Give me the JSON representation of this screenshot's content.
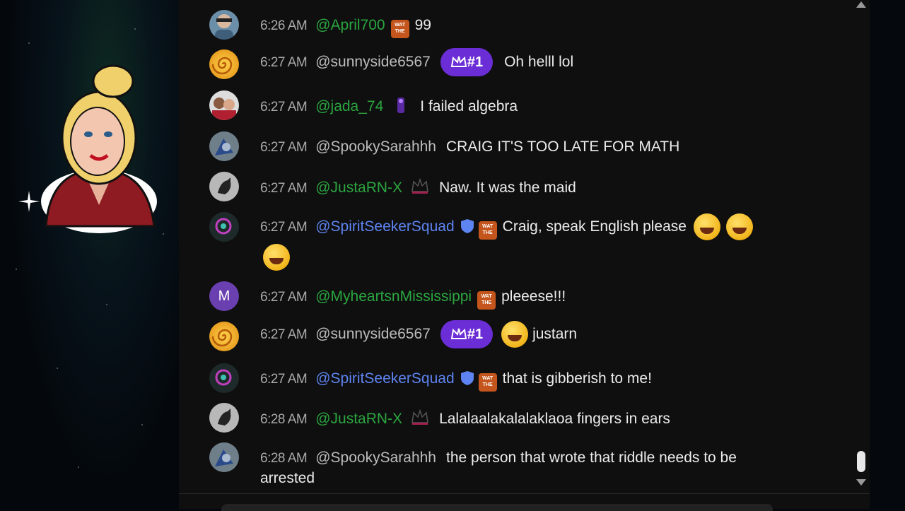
{
  "messages": [
    {
      "time": "6:26 AM",
      "user": "@April700",
      "text": "99"
    },
    {
      "time": "6:27 AM",
      "user": "@sunnyside6567",
      "badge": "#1",
      "text": "Oh helll lol"
    },
    {
      "time": "6:27 AM",
      "user": "@jada_74",
      "text": "I failed algebra"
    },
    {
      "time": "6:27 AM",
      "user": "@SpookySarahhh",
      "text": "CRAIG IT'S TOO LATE FOR MATH"
    },
    {
      "time": "6:27 AM",
      "user": "@JustaRN-X",
      "text": "Naw. It was the maid"
    },
    {
      "time": "6:27 AM",
      "user": "@SpiritSeekerSquad",
      "text": "Craig, speak English please"
    },
    {
      "time": "6:27 AM",
      "user": "@MyheartsnMississippi",
      "avatar_letter": "M",
      "text": "pleeese!!!"
    },
    {
      "time": "6:27 AM",
      "user": "@sunnyside6567",
      "badge": "#1",
      "text": "justarn"
    },
    {
      "time": "6:27 AM",
      "user": "@SpiritSeekerSquad",
      "text": "that is gibberish to me!"
    },
    {
      "time": "6:28 AM",
      "user": "@JustaRN-X",
      "text": "Lalalaalakalalaklaoa fingers in ears"
    },
    {
      "time": "6:28 AM",
      "user": "@SpookySarahhh",
      "text": "the person that wrote that riddle needs to be arrested"
    }
  ],
  "badge_emoji_text": "WAT THE",
  "colors": {
    "chat_bg": "#0f0f0f",
    "member_green": "#2ba640",
    "moderator_blue": "#5e84f1",
    "badge_purple": "#6b2ed6",
    "time_gray": "#aaaaaa"
  },
  "icons": {
    "member_badge": "crown-icon",
    "verified": "shield-icon",
    "emoji": "rolling-laughing-emoji",
    "scroll_up": "triangle-up-icon",
    "scroll_down": "triangle-down-icon"
  }
}
